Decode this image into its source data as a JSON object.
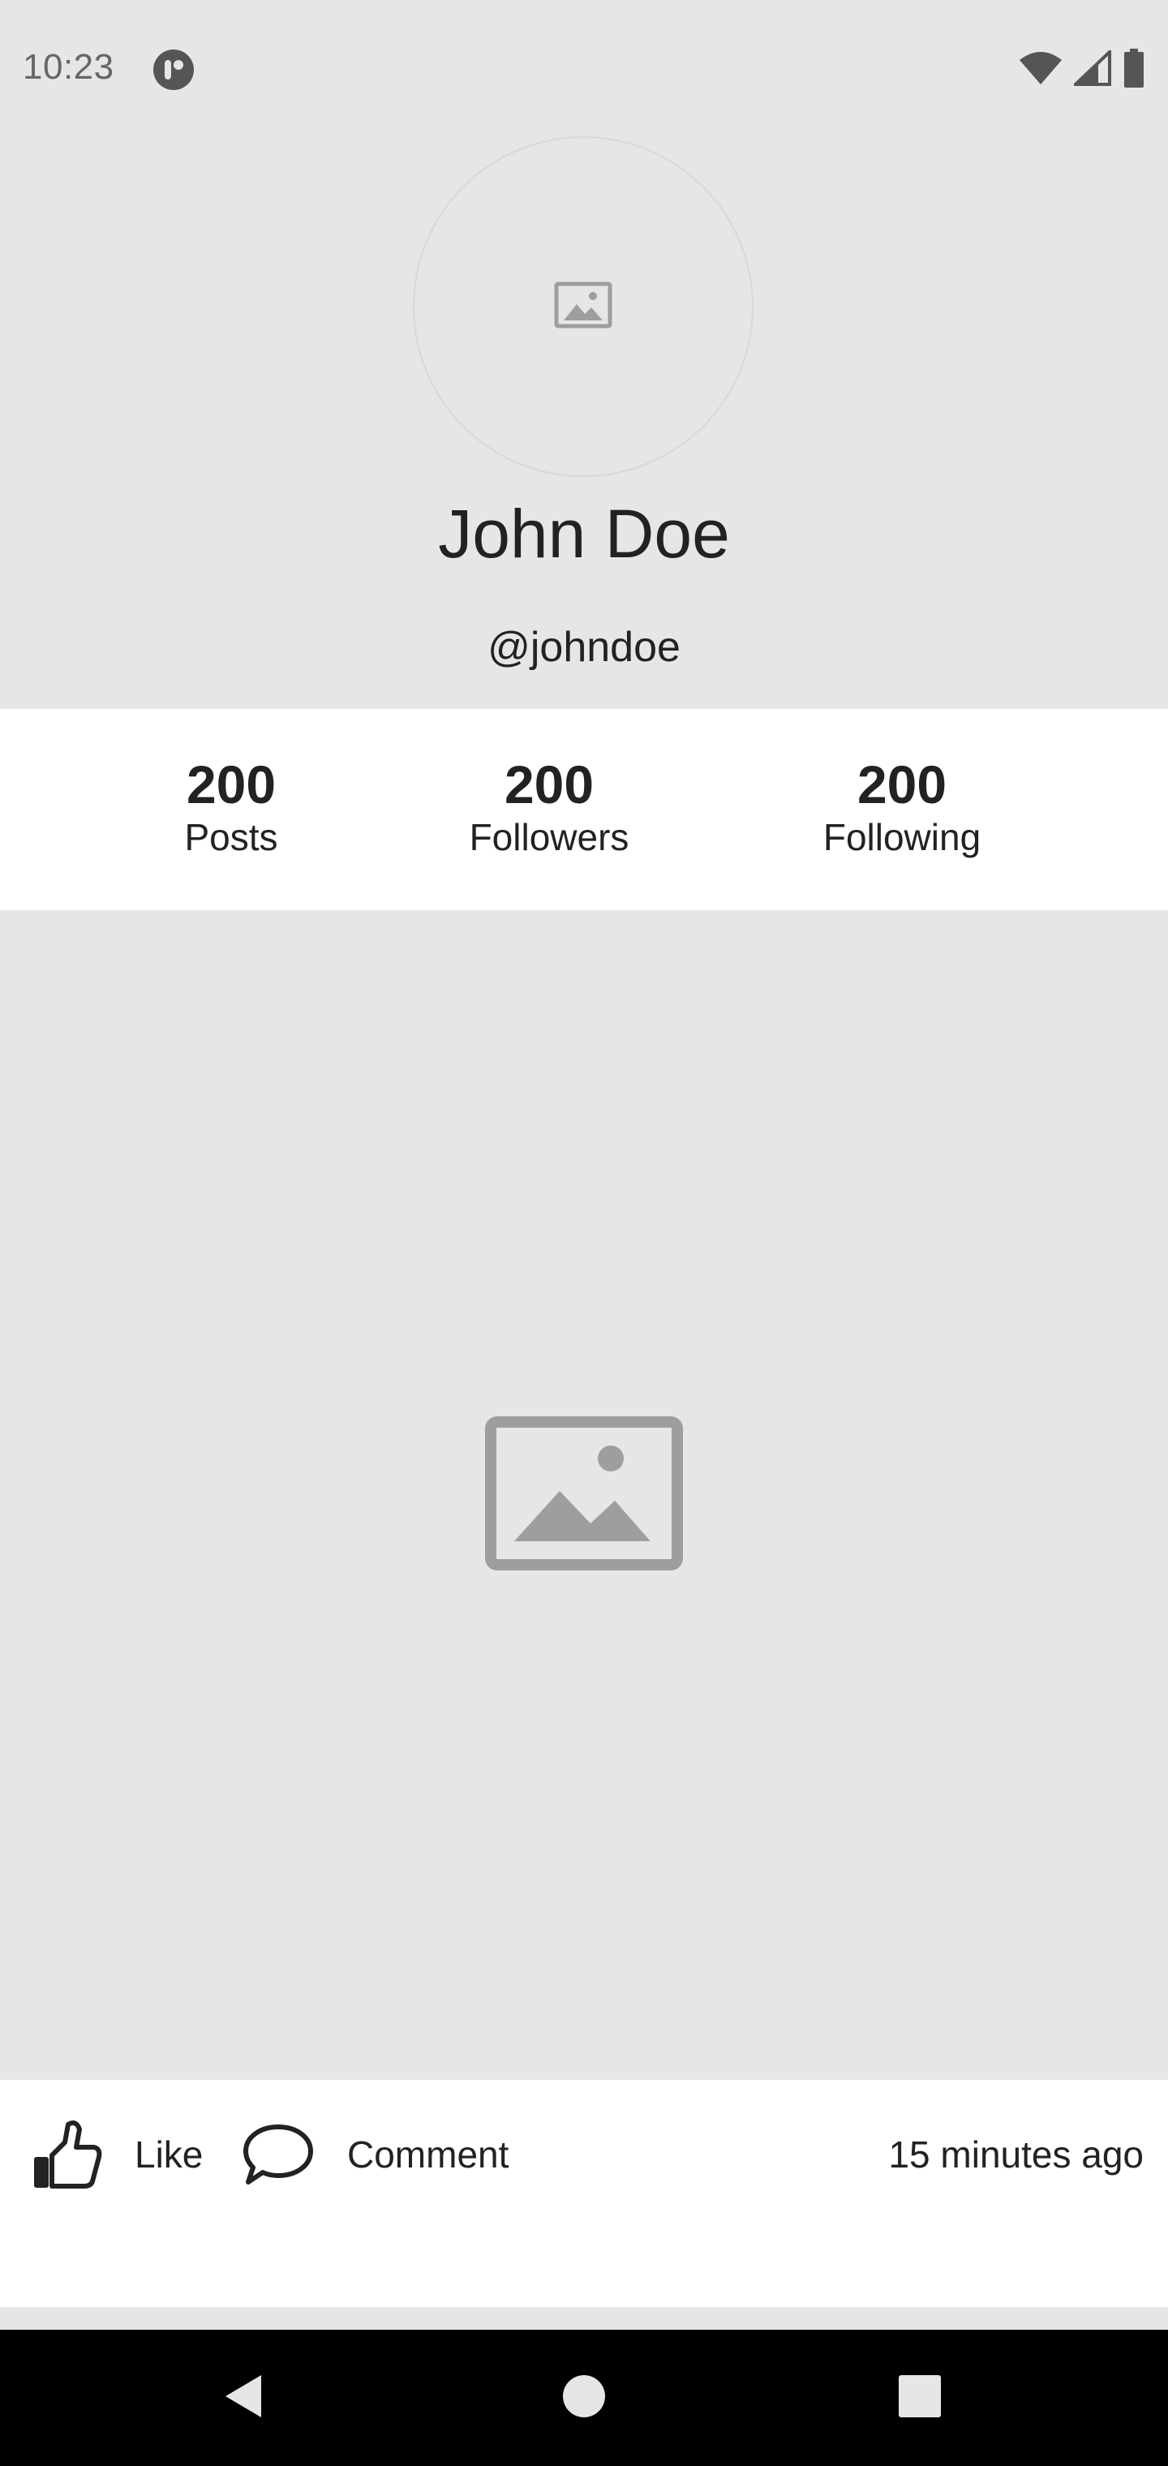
{
  "status_bar": {
    "time": "10:23",
    "icons": [
      "app-notification-icon",
      "wifi-icon",
      "cellular-signal-icon",
      "battery-icon"
    ]
  },
  "profile": {
    "avatar_icon": "image-placeholder-icon",
    "name": "John Doe",
    "handle": "@johndoe"
  },
  "stats": [
    {
      "value": "200",
      "label": "Posts"
    },
    {
      "value": "200",
      "label": "Followers"
    },
    {
      "value": "200",
      "label": "Following"
    }
  ],
  "post": {
    "image_icon": "image-placeholder-icon",
    "like_label": "Like",
    "like_icon": "thumbs-up-icon",
    "comment_label": "Comment",
    "comment_icon": "speech-bubble-icon",
    "timestamp": "15 minutes ago"
  },
  "nav": {
    "icons": [
      "back-icon",
      "home-icon",
      "recents-icon"
    ]
  },
  "colors": {
    "background_gray": "#e6e6e6",
    "surface_white": "#ffffff",
    "text_dark": "#222222",
    "placeholder_gray": "#9e9e9e",
    "nav_bar": "#000000"
  }
}
